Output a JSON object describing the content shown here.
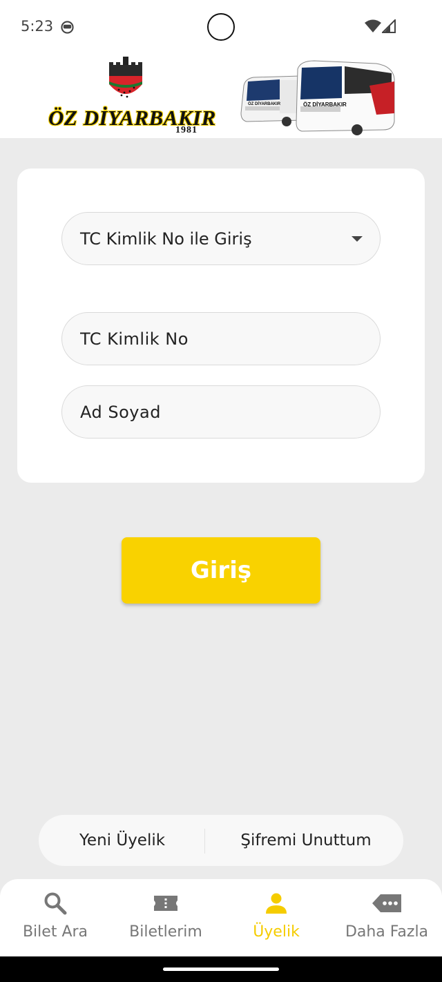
{
  "status_bar": {
    "time": "5:23",
    "icons": [
      "face-icon",
      "wifi-icon",
      "signal-icon"
    ]
  },
  "header": {
    "brand": "ÖZ DİYARBAKIR",
    "year": "1981",
    "bus_brand": "ÖZ DİYARBAKIR"
  },
  "login": {
    "login_type": "TC Kimlik No ile Giriş",
    "tc_placeholder": "TC Kimlik No",
    "name_placeholder": "Ad Soyad",
    "submit_label": "Giriş"
  },
  "links": {
    "register": "Yeni Üyelik",
    "forgot_password": "Şifremi Unuttum"
  },
  "bottom_nav": {
    "items": [
      {
        "label": "Bilet Ara",
        "icon": "search-icon"
      },
      {
        "label": "Biletlerim",
        "icon": "ticket-icon"
      },
      {
        "label": "Üyelik",
        "icon": "person-icon"
      },
      {
        "label": "Daha Fazla",
        "icon": "more-icon"
      }
    ],
    "active_index": 2
  },
  "colors": {
    "accent": "#f9d200",
    "background": "#ebebeb",
    "card": "#ffffff",
    "inactive_nav": "#777777"
  }
}
